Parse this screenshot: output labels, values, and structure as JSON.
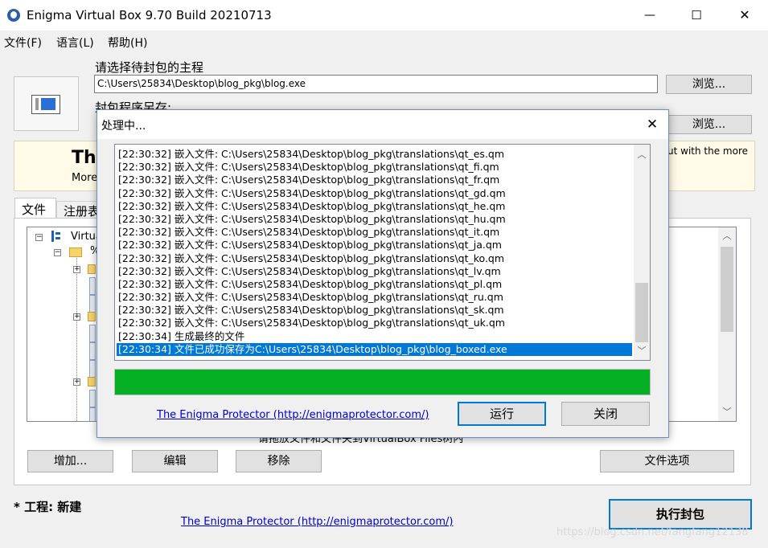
{
  "window": {
    "title": "Enigma Virtual Box 9.70 Build 20210713",
    "controls": {
      "minimize": "—",
      "maximize": "☐",
      "close": "✕"
    }
  },
  "menu": [
    "文件(F)",
    "语言(L)",
    "帮助(H)"
  ],
  "main": {
    "input_label": "请选择待封包的主程",
    "input_value": "C:\\Users\\25834\\Desktop\\blog_pkg\\blog.exe",
    "browse_label": "浏览...",
    "output_label": "封包程序另存:",
    "browse2_label": "浏览...",
    "banner_title": "Th",
    "banner_sub": "More",
    "banner_right": "ut with the more",
    "tabs": [
      "文件",
      "注册表"
    ],
    "tree_root": "Virtua",
    "tree_child": "%",
    "drop_hint": "请拖放文件和文件夹到VirtualBox Files树内",
    "buttons": {
      "add": "增加...",
      "edit": "编辑",
      "remove": "移除",
      "file_options": "文件选项"
    },
    "project_label": "* 工程: 新建",
    "footer_link": "The Enigma Protector (http://enigmaprotector.com/)",
    "run_label": "执行封包",
    "watermark": "https://blog.csdn.net/fangfang12138"
  },
  "dialog": {
    "title": "处理中...",
    "close": "✕",
    "log": [
      "[22:30:32] 嵌入文件: C:\\Users\\25834\\Desktop\\blog_pkg\\translations\\qt_es.qm",
      "[22:30:32] 嵌入文件: C:\\Users\\25834\\Desktop\\blog_pkg\\translations\\qt_fi.qm",
      "[22:30:32] 嵌入文件: C:\\Users\\25834\\Desktop\\blog_pkg\\translations\\qt_fr.qm",
      "[22:30:32] 嵌入文件: C:\\Users\\25834\\Desktop\\blog_pkg\\translations\\qt_gd.qm",
      "[22:30:32] 嵌入文件: C:\\Users\\25834\\Desktop\\blog_pkg\\translations\\qt_he.qm",
      "[22:30:32] 嵌入文件: C:\\Users\\25834\\Desktop\\blog_pkg\\translations\\qt_hu.qm",
      "[22:30:32] 嵌入文件: C:\\Users\\25834\\Desktop\\blog_pkg\\translations\\qt_it.qm",
      "[22:30:32] 嵌入文件: C:\\Users\\25834\\Desktop\\blog_pkg\\translations\\qt_ja.qm",
      "[22:30:32] 嵌入文件: C:\\Users\\25834\\Desktop\\blog_pkg\\translations\\qt_ko.qm",
      "[22:30:32] 嵌入文件: C:\\Users\\25834\\Desktop\\blog_pkg\\translations\\qt_lv.qm",
      "[22:30:32] 嵌入文件: C:\\Users\\25834\\Desktop\\blog_pkg\\translations\\qt_pl.qm",
      "[22:30:32] 嵌入文件: C:\\Users\\25834\\Desktop\\blog_pkg\\translations\\qt_ru.qm",
      "[22:30:32] 嵌入文件: C:\\Users\\25834\\Desktop\\blog_pkg\\translations\\qt_sk.qm",
      "[22:30:32] 嵌入文件: C:\\Users\\25834\\Desktop\\blog_pkg\\translations\\qt_uk.qm",
      "[22:30:34] 生成最终的文件",
      "[22:30:34] 文件已成功保存为C:\\Users\\25834\\Desktop\\blog_pkg\\blog_boxed.exe"
    ],
    "progress": 1.0,
    "progress_color": "#06b025",
    "link": "The Enigma Protector (http://enigmaprotector.com/)",
    "run_label": "运行",
    "close_label": "关闭"
  },
  "colors": {
    "selection": "#0078d7",
    "accent_border": "#0078d7",
    "banner_bg": "#fffbe8"
  }
}
